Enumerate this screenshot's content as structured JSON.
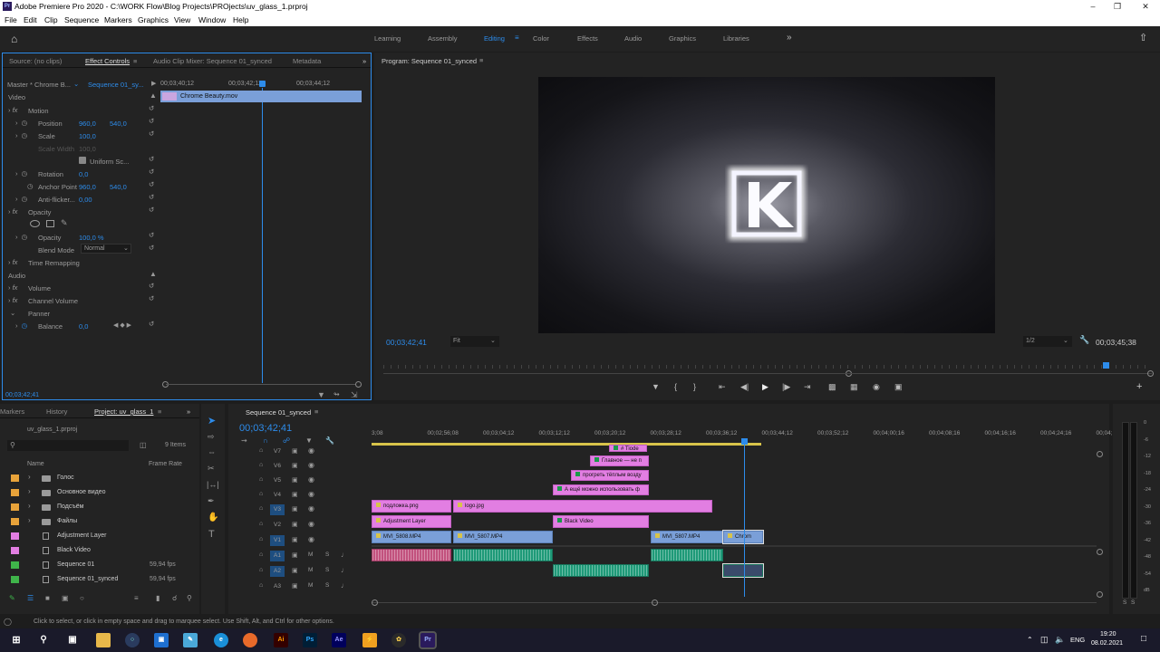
{
  "app": {
    "title": "Adobe Premiere Pro 2020 - C:\\WORK Flow\\Blog Projects\\PROjects\\uv_glass_1.prproj"
  },
  "menu": [
    "File",
    "Edit",
    "Clip",
    "Sequence",
    "Markers",
    "Graphics",
    "View",
    "Window",
    "Help"
  ],
  "workspaces": [
    "Learning",
    "Assembly",
    "Editing",
    "Color",
    "Effects",
    "Audio",
    "Graphics",
    "Libraries"
  ],
  "effect_tabs": {
    "source": "Source: (no clips)",
    "effect_controls": "Effect Controls",
    "mixer": "Audio Clip Mixer: Sequence 01_synced",
    "metadata": "Metadata"
  },
  "effect_header": {
    "master": "Master * Chrome B...",
    "sequence": "Sequence 01_sy...",
    "t1": "00;03;40;12",
    "t2": "00;03;42;12",
    "t3": "00;03;44;12",
    "clip": "Chrome Beauty.mov"
  },
  "effect_props": {
    "video": "Video",
    "motion": "Motion",
    "position": "Position",
    "pos_x": "960,0",
    "pos_y": "540,0",
    "scale": "Scale",
    "scale_val": "100,0",
    "scale_width": "Scale Width",
    "scale_width_val": "100,0",
    "uniform": "Uniform Sc...",
    "rotation": "Rotation",
    "rotation_val": "0,0",
    "anchor": "Anchor Point",
    "anchor_x": "960,0",
    "anchor_y": "540,0",
    "antiflicker": "Anti-flicker...",
    "antiflicker_val": "0,00",
    "opacity": "Opacity",
    "opacity_label": "Opacity",
    "opacity_val": "100,0 %",
    "blend": "Blend Mode",
    "blend_val": "Normal",
    "time_remap": "Time Remapping",
    "audio": "Audio",
    "volume": "Volume",
    "channel_volume": "Channel Volume",
    "panner": "Panner",
    "balance": "Balance",
    "balance_val": "0,0"
  },
  "effect_timecode": "00;03;42;41",
  "program": {
    "title": "Program: Sequence 01_synced",
    "timecode": "00;03;42;41",
    "fit": "Fit",
    "res": "1/2",
    "duration": "00;03;45;38"
  },
  "project_tabs": {
    "markers": "Markers",
    "history": "History",
    "project": "Project: uv_glass_1"
  },
  "project": {
    "file": "uv_glass_1.prproj",
    "items": "9 Items",
    "col_name": "Name",
    "col_rate": "Frame Rate",
    "rows": [
      {
        "name": "Голос",
        "rate": "",
        "color": "#e8a33a",
        "type": "folder"
      },
      {
        "name": "Основное видео",
        "rate": "",
        "color": "#e8a33a",
        "type": "folder"
      },
      {
        "name": "Подсъём",
        "rate": "",
        "color": "#e8a33a",
        "type": "folder"
      },
      {
        "name": "Файлы",
        "rate": "",
        "color": "#e8a33a",
        "type": "folder"
      },
      {
        "name": "Adjustment Layer",
        "rate": "",
        "color": "#e27ee2",
        "type": "item"
      },
      {
        "name": "Black Video",
        "rate": "",
        "color": "#e27ee2",
        "type": "item"
      },
      {
        "name": "Sequence 01",
        "rate": "59,94 fps",
        "color": "#3fb44a",
        "type": "item"
      },
      {
        "name": "Sequence 01_synced",
        "rate": "59,94 fps",
        "color": "#3fb44a",
        "type": "item"
      }
    ]
  },
  "timeline": {
    "tab": "Sequence 01_synced",
    "timecode": "00;03;42;41",
    "ruler": [
      "3;08",
      "00;02;56;08",
      "00;03;04;12",
      "00;03;12;12",
      "00;03;20;12",
      "00;03;28;12",
      "00;03;36;12",
      "00;03;44;12",
      "00;03;52;12",
      "00;04;00;16",
      "00;04;08;16",
      "00;04;16;16",
      "00;04;24;16",
      "00;04;32;"
    ],
    "tracks": [
      "V7",
      "V6",
      "V5",
      "V4",
      "V3",
      "V2",
      "V1",
      "A1",
      "A2",
      "A3"
    ],
    "clips": [
      "# Tiode",
      "Главное — не п",
      "прогреть тёплым возду",
      "А ещё можно использовать ф",
      "подложка.png",
      "logo.jpg",
      "Adjustment Layer",
      "Black Video",
      "MVI_5808.MP4",
      "MVI_5807.MP4",
      "MVI_5807.MP4",
      "Chrom"
    ],
    "meter": [
      "0",
      "-6",
      "-12",
      "-18",
      "-24",
      "-30",
      "-36",
      "-42",
      "-48",
      "-54",
      "dB"
    ],
    "solo": [
      "S",
      "S"
    ]
  },
  "status": "Click to select, or click in empty space and drag to marquee select. Use Shift, Alt, and Ctrl for other options.",
  "tray": {
    "lang": "ENG",
    "time": "19:20",
    "date": "08.02.2021"
  }
}
